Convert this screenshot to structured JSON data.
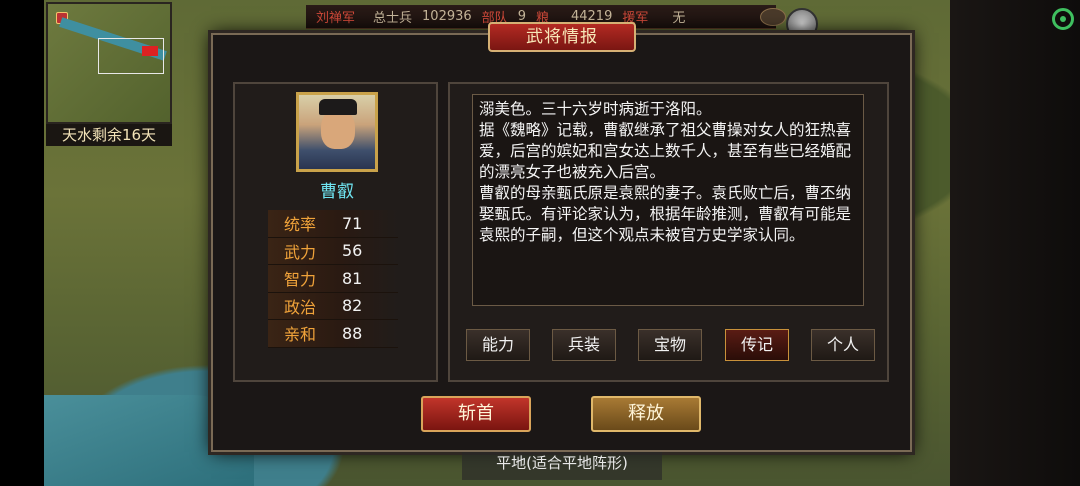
{
  "top_bar": {
    "faction": "刘禅军",
    "troops_label": "总士兵",
    "troops_value": "102936",
    "units_label": "部队",
    "units_value": "9",
    "food_label": "粮",
    "food_value": "44219",
    "reinforce_label": "援军",
    "reinforce_value": "无"
  },
  "minimap": {
    "label": "天水剩余16天"
  },
  "dialog": {
    "title": "武将情报",
    "general": {
      "name": "曹叡",
      "stats": [
        {
          "label": "统率",
          "value": "71"
        },
        {
          "label": "武力",
          "value": "56"
        },
        {
          "label": "智力",
          "value": "81"
        },
        {
          "label": "政治",
          "value": "82"
        },
        {
          "label": "亲和",
          "value": "88"
        }
      ]
    },
    "biography": [
      "溺美色。三十六岁时病逝于洛阳。",
      "据《魏略》记载，曹叡继承了祖父曹操对女人的狂热喜爱，后宫的嫔妃和宫女达上数千人，甚至有些已经婚配的漂亮女子也被充入后宫。",
      "曹叡的母亲甄氏原是袁熙的妻子。袁氏败亡后，曹丕纳娶甄氏。有评论家认为，根据年龄推测，曹叡有可能是袁熙的子嗣，但这个观点未被官方史学家认同。"
    ],
    "tabs": [
      {
        "label": "能力"
      },
      {
        "label": "兵装"
      },
      {
        "label": "宝物"
      },
      {
        "label": "传记",
        "active": true
      },
      {
        "label": "个人"
      }
    ],
    "execute_button": "斩首",
    "release_button": "释放"
  },
  "terrain_label": "平地(适合平地阵形)",
  "icons": [
    "wifi-icon",
    "faction-flag-icon",
    "settings-circle-icon"
  ]
}
